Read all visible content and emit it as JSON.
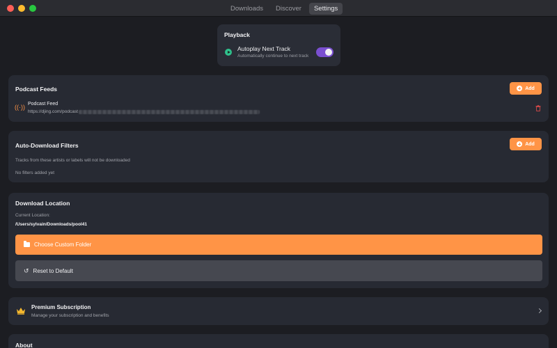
{
  "window": {
    "tabs": [
      {
        "label": "Downloads",
        "active": false
      },
      {
        "label": "Discover",
        "active": false
      },
      {
        "label": "Settings",
        "active": true
      }
    ]
  },
  "playback": {
    "title": "Playback",
    "autoplay_label": "Autoplay Next Track",
    "autoplay_description": "Automatically continue to next track",
    "autoplay_enabled": true,
    "toggle_color": "#7a4fd0"
  },
  "podcast_feeds": {
    "title": "Podcast Feeds",
    "add_label": "Add",
    "feeds": [
      {
        "name": "Podcast Feed",
        "url": "https://djing.com/podcast"
      }
    ]
  },
  "auto_download": {
    "title": "Auto-Download Filters",
    "add_label": "Add",
    "description": "Tracks from these artists or labels will not be downloaded",
    "empty_text": "No filters added yet"
  },
  "download_location": {
    "title": "Download Location",
    "current_label": "Current Location:",
    "path": "/Users/sylvain/Downloads/pool41",
    "choose_label": "Choose Custom Folder",
    "reset_label": "Reset to Default"
  },
  "premium": {
    "title": "Premium Subscription",
    "description": "Manage your subscription and benefits"
  },
  "about": {
    "title": "About"
  },
  "colors": {
    "accent": "#ff9446",
    "success": "#2fc18c",
    "danger": "#d94a4a",
    "crown": "#f5b82e"
  },
  "icons": [
    "play-icon",
    "plus-icon",
    "broadcast-icon",
    "trash-icon",
    "folder-icon",
    "reset-icon",
    "crown-icon",
    "chevron-right-icon"
  ]
}
